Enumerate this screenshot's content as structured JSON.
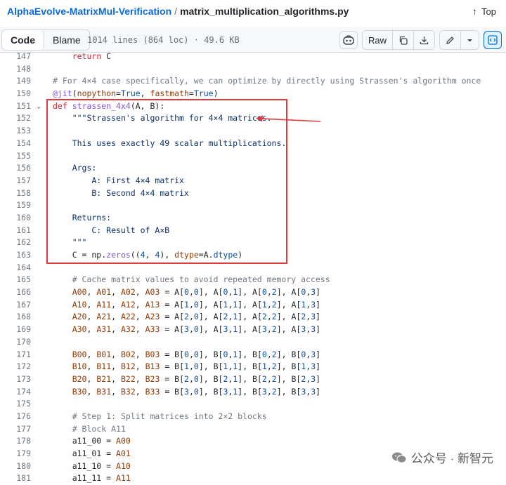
{
  "header": {
    "repo": "AlphaEvolve-MatrixMul-Verification",
    "separator": "/",
    "file": "matrix_multiplication_algorithms.py",
    "top_label": "Top"
  },
  "toolbar": {
    "code_label": "Code",
    "blame_label": "Blame",
    "meta": "1014 lines (864 loc) · 49.6 KB",
    "raw_label": "Raw"
  },
  "code": {
    "lines": [
      {
        "n": "147",
        "html": "    <span class='k'>return</span> C"
      },
      {
        "n": "148",
        "html": ""
      },
      {
        "n": "149",
        "html": "<span class='c'># For 4×4 case specifically, we can optimize by directly using Strassen's algorithm once</span>"
      },
      {
        "n": "150",
        "html": "<span class='f'>@jit</span>(<span class='v'>nopython</span>=<span class='n'>True</span>, <span class='v'>fastmath</span>=<span class='n'>True</span>)"
      },
      {
        "n": "151",
        "html": "<span class='k'>def</span> <span class='f'>strassen_4x4</span>(A, B):",
        "fold": true
      },
      {
        "n": "152",
        "html": "    <span class='s'>\"\"\"Strassen's algorithm for 4×4 matrices.</span>"
      },
      {
        "n": "153",
        "html": ""
      },
      {
        "n": "154",
        "html": "<span class='s'>    This uses exactly 49 scalar multiplications.</span>"
      },
      {
        "n": "155",
        "html": ""
      },
      {
        "n": "156",
        "html": "<span class='s'>    Args:</span>"
      },
      {
        "n": "157",
        "html": "<span class='s'>        A: First 4×4 matrix</span>"
      },
      {
        "n": "158",
        "html": "<span class='s'>        B: Second 4×4 matrix</span>"
      },
      {
        "n": "159",
        "html": ""
      },
      {
        "n": "160",
        "html": "<span class='s'>    Returns:</span>"
      },
      {
        "n": "161",
        "html": "<span class='s'>        C: Result of A×B</span>"
      },
      {
        "n": "162",
        "html": "<span class='s'>    \"\"\"</span>"
      },
      {
        "n": "163",
        "html": "    C = np.<span class='f'>zeros</span>((<span class='n'>4</span>, <span class='n'>4</span>), <span class='v'>dtype</span>=A.<span class='n'>dtype</span>)"
      },
      {
        "n": "164",
        "html": ""
      },
      {
        "n": "165",
        "html": "    <span class='c'># Cache matrix values to avoid repeated memory access</span>"
      },
      {
        "n": "166",
        "html": "    <span class='v'>A00</span>, <span class='v'>A01</span>, <span class='v'>A02</span>, <span class='v'>A03</span> = A[<span class='n'>0</span>,<span class='n'>0</span>], A[<span class='n'>0</span>,<span class='n'>1</span>], A[<span class='n'>0</span>,<span class='n'>2</span>], A[<span class='n'>0</span>,<span class='n'>3</span>]"
      },
      {
        "n": "167",
        "html": "    <span class='v'>A10</span>, <span class='v'>A11</span>, <span class='v'>A12</span>, <span class='v'>A13</span> = A[<span class='n'>1</span>,<span class='n'>0</span>], A[<span class='n'>1</span>,<span class='n'>1</span>], A[<span class='n'>1</span>,<span class='n'>2</span>], A[<span class='n'>1</span>,<span class='n'>3</span>]"
      },
      {
        "n": "168",
        "html": "    <span class='v'>A20</span>, <span class='v'>A21</span>, <span class='v'>A22</span>, <span class='v'>A23</span> = A[<span class='n'>2</span>,<span class='n'>0</span>], A[<span class='n'>2</span>,<span class='n'>1</span>], A[<span class='n'>2</span>,<span class='n'>2</span>], A[<span class='n'>2</span>,<span class='n'>3</span>]"
      },
      {
        "n": "169",
        "html": "    <span class='v'>A30</span>, <span class='v'>A31</span>, <span class='v'>A32</span>, <span class='v'>A33</span> = A[<span class='n'>3</span>,<span class='n'>0</span>], A[<span class='n'>3</span>,<span class='n'>1</span>], A[<span class='n'>3</span>,<span class='n'>2</span>], A[<span class='n'>3</span>,<span class='n'>3</span>]"
      },
      {
        "n": "170",
        "html": ""
      },
      {
        "n": "171",
        "html": "    <span class='v'>B00</span>, <span class='v'>B01</span>, <span class='v'>B02</span>, <span class='v'>B03</span> = B[<span class='n'>0</span>,<span class='n'>0</span>], B[<span class='n'>0</span>,<span class='n'>1</span>], B[<span class='n'>0</span>,<span class='n'>2</span>], B[<span class='n'>0</span>,<span class='n'>3</span>]"
      },
      {
        "n": "172",
        "html": "    <span class='v'>B10</span>, <span class='v'>B11</span>, <span class='v'>B12</span>, <span class='v'>B13</span> = B[<span class='n'>1</span>,<span class='n'>0</span>], B[<span class='n'>1</span>,<span class='n'>1</span>], B[<span class='n'>1</span>,<span class='n'>2</span>], B[<span class='n'>1</span>,<span class='n'>3</span>]"
      },
      {
        "n": "173",
        "html": "    <span class='v'>B20</span>, <span class='v'>B21</span>, <span class='v'>B22</span>, <span class='v'>B23</span> = B[<span class='n'>2</span>,<span class='n'>0</span>], B[<span class='n'>2</span>,<span class='n'>1</span>], B[<span class='n'>2</span>,<span class='n'>2</span>], B[<span class='n'>2</span>,<span class='n'>3</span>]"
      },
      {
        "n": "174",
        "html": "    <span class='v'>B30</span>, <span class='v'>B31</span>, <span class='v'>B32</span>, <span class='v'>B33</span> = B[<span class='n'>3</span>,<span class='n'>0</span>], B[<span class='n'>3</span>,<span class='n'>1</span>], B[<span class='n'>3</span>,<span class='n'>2</span>], B[<span class='n'>3</span>,<span class='n'>3</span>]"
      },
      {
        "n": "175",
        "html": ""
      },
      {
        "n": "176",
        "html": "    <span class='c'># Step 1: Split matrices into 2×2 blocks</span>"
      },
      {
        "n": "177",
        "html": "    <span class='c'># Block A11</span>"
      },
      {
        "n": "178",
        "html": "    a11_00 = <span class='v'>A00</span>"
      },
      {
        "n": "179",
        "html": "    a11_01 = <span class='v'>A01</span>"
      },
      {
        "n": "180",
        "html": "    a11_10 = <span class='v'>A10</span>"
      },
      {
        "n": "181",
        "html": "    a11_11 = <span class='v'>A11</span>"
      }
    ]
  },
  "watermark": {
    "text": "公众号 · 新智元"
  }
}
